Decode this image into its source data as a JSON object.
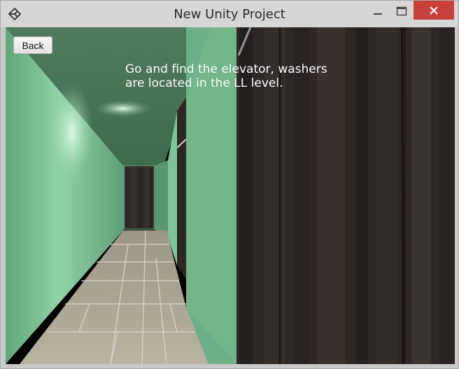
{
  "window": {
    "title": "New Unity Project",
    "app_icon": "unity-icon",
    "controls": {
      "minimize_icon": "minimize-icon",
      "maximize_icon": "maximize-icon",
      "close_icon": "close-icon"
    },
    "close_color": "#c7403a"
  },
  "game": {
    "back_button_label": "Back",
    "hint_line1": "Go and find the elevator, washers",
    "hint_line2": "are located in the LL level.",
    "wall_color": "#72b68a",
    "door_color": "#2e2926"
  }
}
